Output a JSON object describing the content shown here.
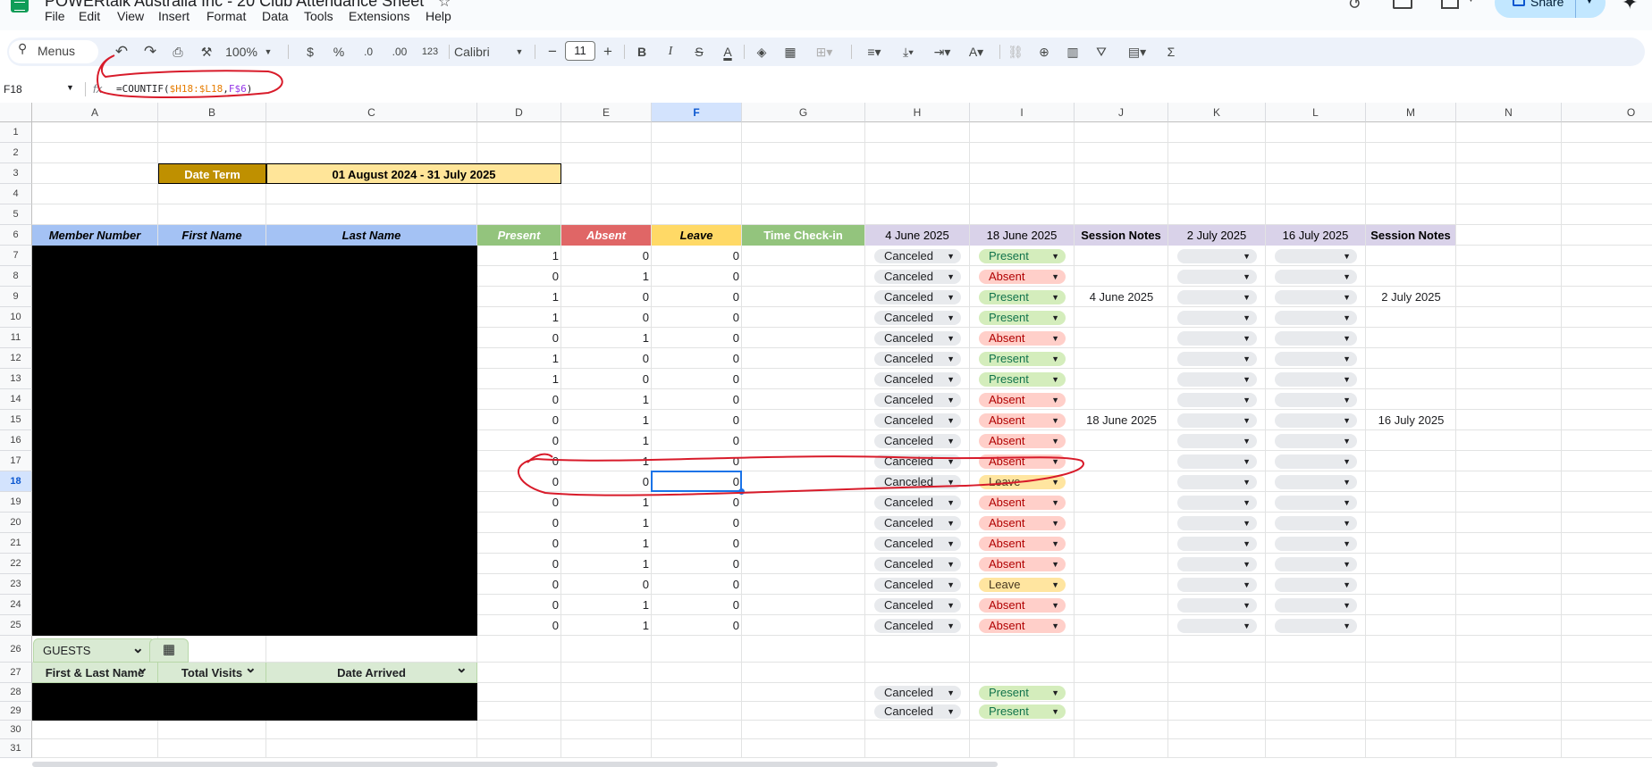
{
  "app": {
    "title": "POWERtalk Australia Inc - 20 Club Attendance Sheet",
    "menus": [
      "File",
      "Edit",
      "View",
      "Insert",
      "Format",
      "Data",
      "Tools",
      "Extensions",
      "Help"
    ],
    "share_label": "Share"
  },
  "toolbar": {
    "search_label": "Menus",
    "zoom": "100%",
    "currency": "$",
    "percent": "%",
    "dec_decrease": ".0",
    "dec_increase": ".00",
    "number_format": "123",
    "font": "Calibri",
    "font_size": "11",
    "minus": "−",
    "plus": "+",
    "bold": "B",
    "italic": "I"
  },
  "formula_bar": {
    "name_box": "F18",
    "fx": "fx",
    "formula_prefix": "=COUNTIF(",
    "formula_ref1": "$H18:$L18",
    "formula_sep": ",",
    "formula_ref2": "F$6",
    "formula_suffix": ")"
  },
  "columns": [
    "A",
    "B",
    "C",
    "D",
    "E",
    "F",
    "G",
    "H",
    "I",
    "J",
    "K",
    "L",
    "M",
    "N",
    "O"
  ],
  "rows": [
    "1",
    "2",
    "3",
    "4",
    "5",
    "6",
    "7",
    "8",
    "9",
    "10",
    "11",
    "12",
    "13",
    "14",
    "15",
    "16",
    "17",
    "18",
    "19",
    "20",
    "21",
    "22",
    "23",
    "24",
    "25",
    "26",
    "27",
    "28",
    "29",
    "30",
    "31"
  ],
  "sheet": {
    "date_term_label": "Date Term",
    "date_term_value": "01 August 2024 - 31 July 2025",
    "headers": {
      "member_number": "Member Number",
      "first_name": "First Name",
      "last_name": "Last Name",
      "present": "Present",
      "absent": "Absent",
      "leave": "Leave",
      "time_checkin": "Time Check-in",
      "h": "4 June 2025",
      "i": "18 June 2025",
      "j": "Session Notes",
      "k": "2 July 2025",
      "l": "16 July 2025",
      "m": "Session Notes"
    },
    "data_rows": [
      {
        "d": "1",
        "e": "0",
        "f": "0",
        "h": "Canceled",
        "i": "Present"
      },
      {
        "d": "0",
        "e": "1",
        "f": "0",
        "h": "Canceled",
        "i": "Absent"
      },
      {
        "d": "1",
        "e": "0",
        "f": "0",
        "h": "Canceled",
        "i": "Present"
      },
      {
        "d": "1",
        "e": "0",
        "f": "0",
        "h": "Canceled",
        "i": "Present"
      },
      {
        "d": "0",
        "e": "1",
        "f": "0",
        "h": "Canceled",
        "i": "Absent"
      },
      {
        "d": "1",
        "e": "0",
        "f": "0",
        "h": "Canceled",
        "i": "Present"
      },
      {
        "d": "1",
        "e": "0",
        "f": "0",
        "h": "Canceled",
        "i": "Present"
      },
      {
        "d": "0",
        "e": "1",
        "f": "0",
        "h": "Canceled",
        "i": "Absent"
      },
      {
        "d": "0",
        "e": "1",
        "f": "0",
        "h": "Canceled",
        "i": "Absent"
      },
      {
        "d": "0",
        "e": "1",
        "f": "0",
        "h": "Canceled",
        "i": "Absent"
      },
      {
        "d": "0",
        "e": "1",
        "f": "0",
        "h": "Canceled",
        "i": "Absent"
      },
      {
        "d": "0",
        "e": "0",
        "f": "0",
        "h": "Canceled",
        "i": "Leave"
      },
      {
        "d": "0",
        "e": "1",
        "f": "0",
        "h": "Canceled",
        "i": "Absent"
      },
      {
        "d": "0",
        "e": "1",
        "f": "0",
        "h": "Canceled",
        "i": "Absent"
      },
      {
        "d": "0",
        "e": "1",
        "f": "0",
        "h": "Canceled",
        "i": "Absent"
      },
      {
        "d": "0",
        "e": "1",
        "f": "0",
        "h": "Canceled",
        "i": "Absent"
      },
      {
        "d": "0",
        "e": "0",
        "f": "0",
        "h": "Canceled",
        "i": "Leave"
      },
      {
        "d": "0",
        "e": "1",
        "f": "0",
        "h": "Canceled",
        "i": "Absent"
      },
      {
        "d": "0",
        "e": "1",
        "f": "0",
        "h": "Canceled",
        "i": "Absent"
      }
    ],
    "session_notes_j": [
      {
        "row": "9",
        "text": "4 June 2025"
      },
      {
        "row": "15",
        "text": "18 June 2025"
      }
    ],
    "session_notes_m": [
      {
        "row": "9",
        "text": "2 July 2025"
      },
      {
        "row": "15",
        "text": "16 July 2025"
      }
    ],
    "guests": {
      "tab_label": "GUESTS",
      "col1": "First & Last Name",
      "col2": "Total Visits",
      "col3": "Date Arrived",
      "rows": [
        {
          "h": "Canceled",
          "i": "Present"
        },
        {
          "h": "Canceled",
          "i": "Present"
        }
      ]
    }
  },
  "colors": {
    "present": "#93c47d",
    "absent": "#e06666",
    "leave": "#ffd966",
    "time_checkin": "#93c47d",
    "date_cols": "#d9d2e9",
    "name_header": "#a4c2f4",
    "date_term_bg": "#bf9000",
    "date_term_value_bg": "#ffe599",
    "annotation": "#d81b2a"
  }
}
